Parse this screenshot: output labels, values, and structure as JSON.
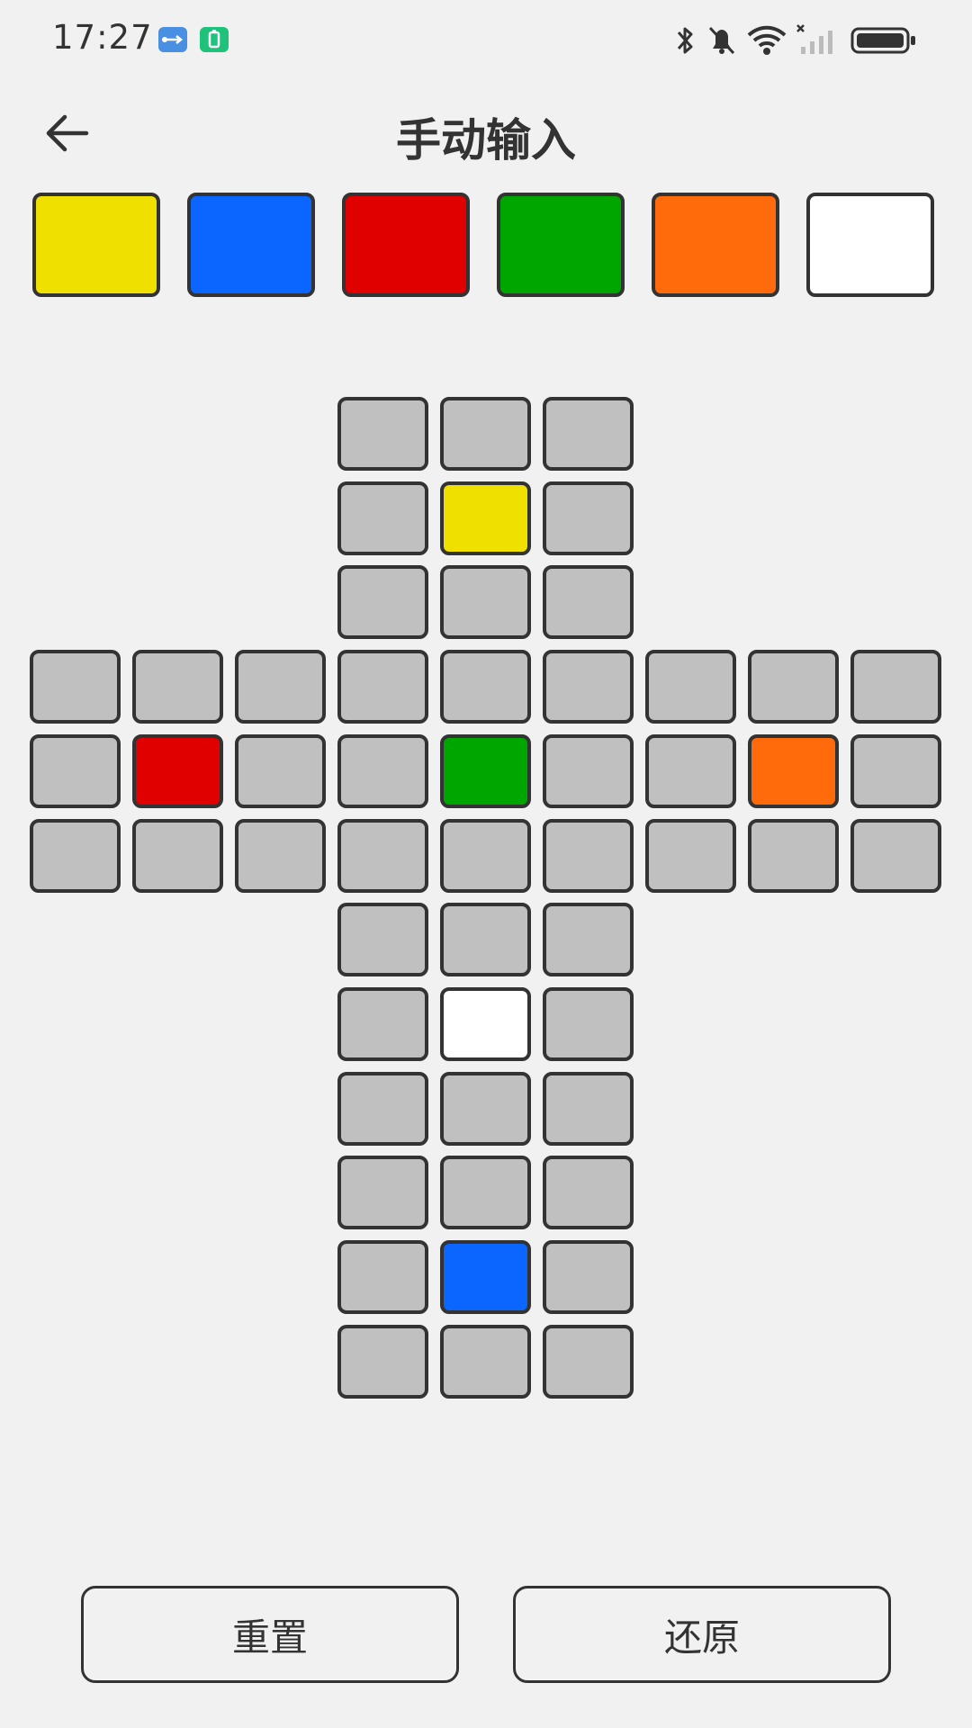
{
  "status_bar": {
    "time": "17:27",
    "icons": [
      "usb-icon",
      "battery-saver-icon",
      "bluetooth-icon",
      "mute-icon",
      "wifi-icon",
      "signal-icon",
      "battery-icon"
    ]
  },
  "header": {
    "title": "手动输入",
    "back_icon": "arrow-left-icon"
  },
  "colors": {
    "yellow": "#f0e000",
    "blue": "#0a66ff",
    "red": "#e00000",
    "green": "#00a600",
    "orange": "#ff6a0a",
    "white": "#ffffff",
    "empty": "#c0c0c0",
    "border": "#333333"
  },
  "palette": [
    "yellow",
    "blue",
    "red",
    "green",
    "orange",
    "white"
  ],
  "cube_net": {
    "rows": [
      "___EEE___",
      "___EYE___",
      "___EEE___",
      "EEEEEEEEE",
      "EREEGEEOE",
      "EEEEEEEEE",
      "___EEE___",
      "___EWE___",
      "___EEE___",
      "___EEE___",
      "___EBE___",
      "___EEE___"
    ],
    "legend": {
      "E": "empty",
      "Y": "yellow",
      "R": "red",
      "G": "green",
      "O": "orange",
      "W": "white",
      "B": "blue"
    }
  },
  "buttons": {
    "reset_label": "重置",
    "restore_label": "还原"
  }
}
